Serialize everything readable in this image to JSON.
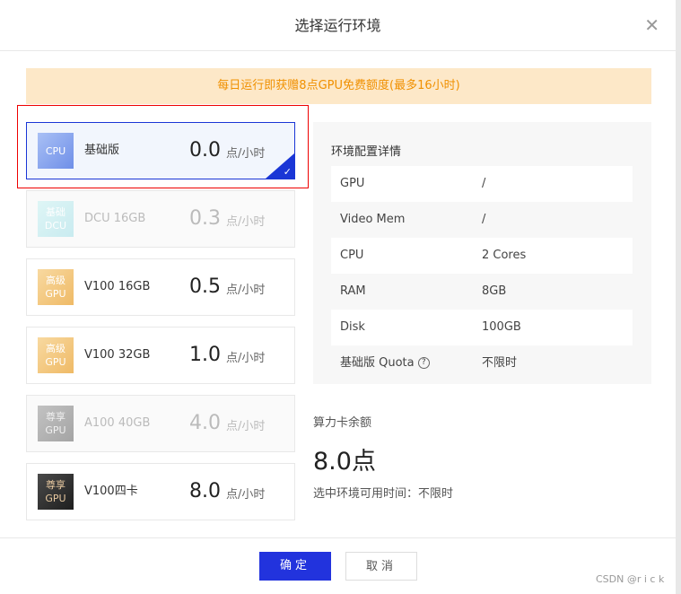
{
  "title": "选择运行环境",
  "banner": "每日运行即获赠8点GPU免费额度(最多16小时)",
  "unit": "点/小时",
  "cards": [
    {
      "badge1": "CPU",
      "badge2": "",
      "name": "基础版",
      "price": "0.0",
      "state": "selected",
      "bg": "linear-gradient(135deg,#a9c0f5,#6f8fe8)",
      "color": "#fff"
    },
    {
      "badge1": "基础",
      "badge2": "DCU",
      "name": "DCU 16GB",
      "price": "0.3",
      "state": "disabled",
      "bg": "linear-gradient(135deg,#d8f5f5,#bde8ee)",
      "color": "#fff"
    },
    {
      "badge1": "高级",
      "badge2": "GPU",
      "name": "V100 16GB",
      "price": "0.5",
      "state": "normal",
      "bg": "linear-gradient(135deg,#f8d9a0,#efba66)",
      "color": "#fff"
    },
    {
      "badge1": "高级",
      "badge2": "GPU",
      "name": "V100 32GB",
      "price": "1.0",
      "state": "normal",
      "bg": "linear-gradient(135deg,#f8d9a0,#efba66)",
      "color": "#fff"
    },
    {
      "badge1": "尊享",
      "badge2": "GPU",
      "name": "A100 40GB",
      "price": "4.0",
      "state": "disabled",
      "bg": "linear-gradient(135deg,#b5b5b5,#8f8f8f)",
      "color": "#eee"
    },
    {
      "badge1": "尊享",
      "badge2": "GPU",
      "name": "V100四卡",
      "price": "8.0",
      "state": "normal",
      "bg": "linear-gradient(135deg,#4a4a4a,#1e1e1e)",
      "color": "#e8c9a0"
    }
  ],
  "details": {
    "title": "环境配置详情",
    "rows": [
      {
        "k": "GPU",
        "v": "/"
      },
      {
        "k": "Video Mem",
        "v": "/"
      },
      {
        "k": "CPU",
        "v": "2 Cores"
      },
      {
        "k": "RAM",
        "v": "8GB"
      },
      {
        "k": "Disk",
        "v": "100GB"
      },
      {
        "k": "基础版 Quota",
        "v": "不限时"
      }
    ]
  },
  "balance": {
    "label": "算力卡余额",
    "value": "8.0点",
    "time": "选中环境可用时间：不限时"
  },
  "buttons": {
    "ok": "确定",
    "cancel": "取消"
  },
  "watermark": "CSDN @r i c k"
}
